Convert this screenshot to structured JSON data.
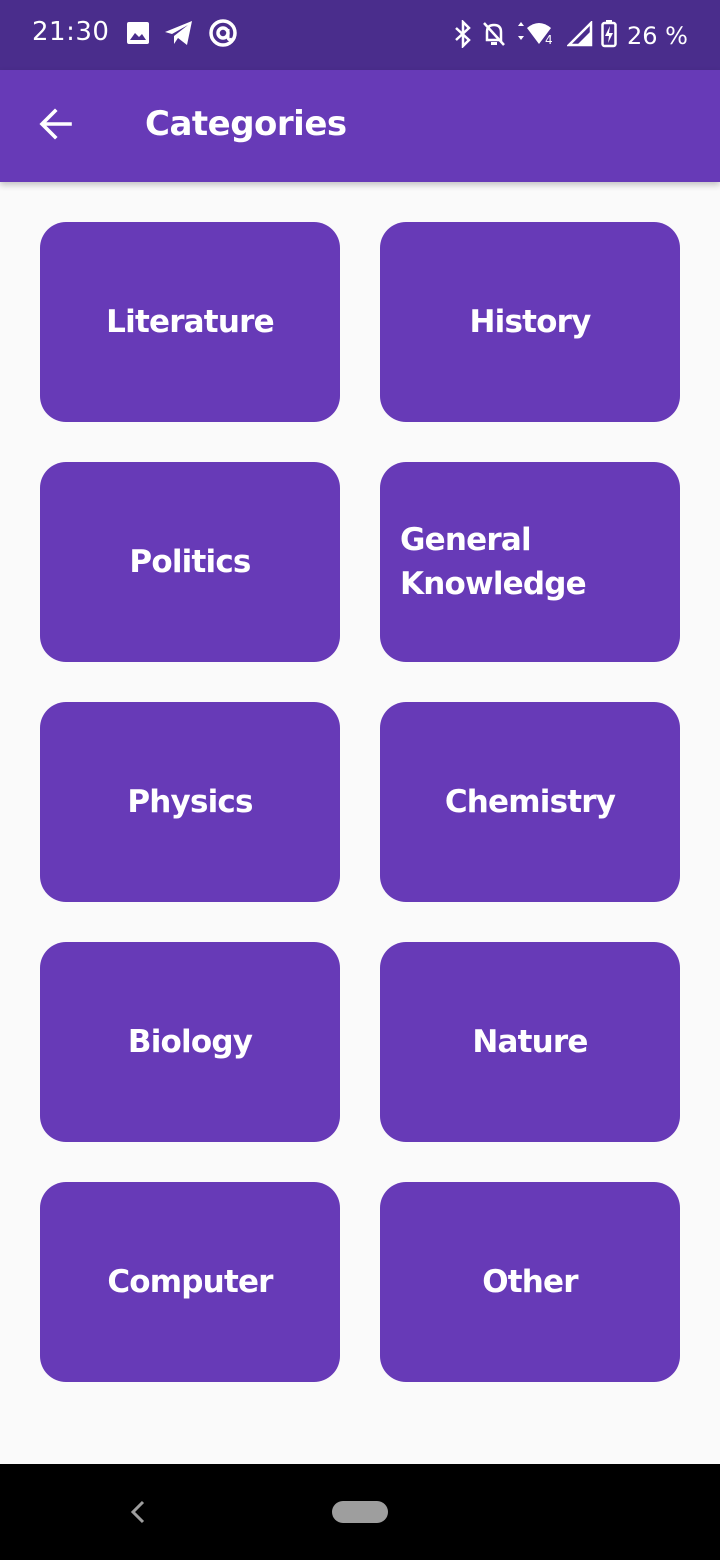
{
  "status_bar": {
    "time": "21:30",
    "battery": "26 %",
    "icons_left": [
      "image-icon",
      "telegram-icon",
      "at-sign-icon"
    ],
    "icons_right": [
      "bluetooth-icon",
      "notifications-off-icon",
      "wifi-icon",
      "cellular-signal-icon",
      "battery-charging-icon"
    ]
  },
  "app_bar": {
    "title": "Categories",
    "back_icon": "arrow-left-icon"
  },
  "categories": [
    {
      "label": "Literature"
    },
    {
      "label": "History"
    },
    {
      "label": "Politics"
    },
    {
      "label": "General Knowledge"
    },
    {
      "label": "Physics"
    },
    {
      "label": "Chemistry"
    },
    {
      "label": "Biology"
    },
    {
      "label": "Nature"
    },
    {
      "label": "Computer"
    },
    {
      "label": "Other"
    }
  ],
  "colors": {
    "primary": "#673ab7",
    "status_bar": "#4a2d8c",
    "background": "#fafafa",
    "nav_bar": "#000000"
  }
}
